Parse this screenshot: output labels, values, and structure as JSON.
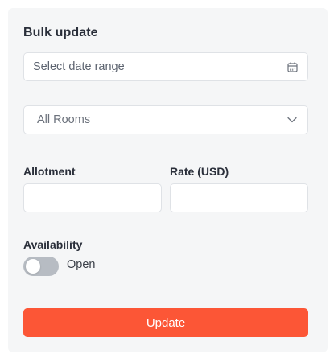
{
  "panel": {
    "title": "Bulk update"
  },
  "date_range": {
    "placeholder": "Select date range",
    "icon": "calendar-icon"
  },
  "rooms_select": {
    "selected": "All Rooms",
    "icon": "chevron-down-icon"
  },
  "allotment": {
    "label": "Allotment",
    "value": ""
  },
  "rate": {
    "label": "Rate (USD)",
    "value": ""
  },
  "availability": {
    "label": "Availability",
    "toggle_label": "Open",
    "toggle_on": false
  },
  "update_button": {
    "label": "Update",
    "color": "#fc5636"
  }
}
